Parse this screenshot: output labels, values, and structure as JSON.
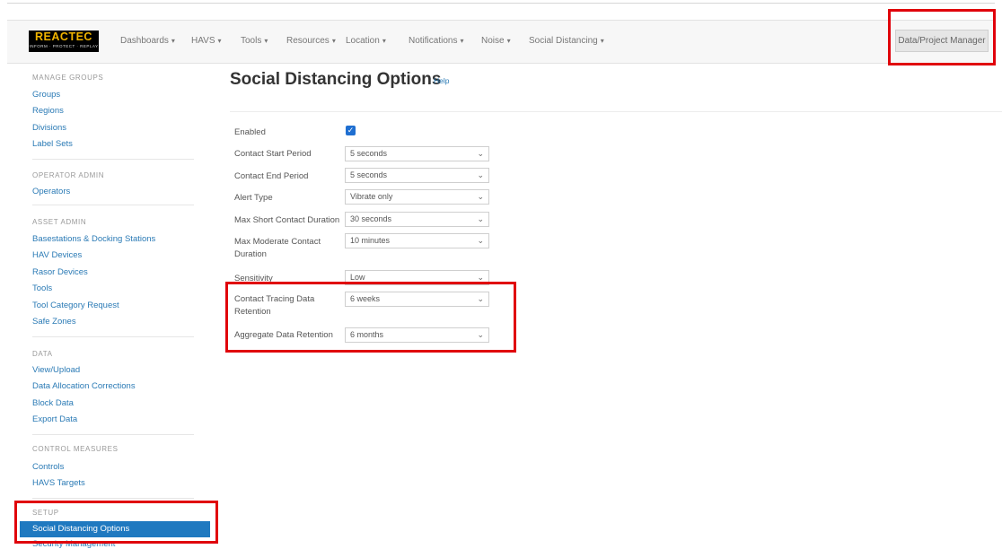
{
  "app": {
    "logo_text": "REACTEC",
    "logo_tagline": "INFORM · PROTECT · REPLAY"
  },
  "nav": {
    "items": [
      {
        "label": "Dashboards",
        "caret": "▾"
      },
      {
        "label": "HAVS",
        "caret": "▾"
      },
      {
        "label": "Tools",
        "caret": "▾"
      },
      {
        "label": "Resources",
        "caret": "▾"
      },
      {
        "label": "Location",
        "caret": "▾"
      },
      {
        "label": "Notifications",
        "caret": "▾"
      },
      {
        "label": "Noise",
        "caret": "▾"
      },
      {
        "label": "Social Distancing",
        "caret": "▾"
      }
    ],
    "right_button": "Data/Project Manager"
  },
  "sidebar": {
    "sections": [
      {
        "heading": "MANAGE GROUPS",
        "links": [
          "Groups",
          "Regions",
          "Divisions",
          "Label Sets"
        ]
      },
      {
        "heading": "OPERATOR ADMIN",
        "links": [
          "Operators"
        ]
      },
      {
        "heading": "ASSET ADMIN",
        "links": [
          "Basestations & Docking Stations",
          "HAV Devices",
          "Rasor Devices",
          "Tools",
          "Tool Category Request",
          "Safe Zones"
        ]
      },
      {
        "heading": "DATA",
        "links": [
          "View/Upload",
          "Data Allocation Corrections",
          "Block Data",
          "Export Data"
        ]
      },
      {
        "heading": "CONTROL MEASURES",
        "links": [
          "Controls",
          "HAVS Targets"
        ]
      },
      {
        "heading": "SETUP",
        "active": "Social Distancing Options",
        "links": [
          "Security Management"
        ]
      }
    ]
  },
  "main": {
    "title": "Social Distancing Options",
    "help_link": "Help",
    "fields": {
      "enabled": {
        "label": "Enabled",
        "checked": true
      },
      "contact_start": {
        "label": "Contact Start Period",
        "value": "5 seconds"
      },
      "contact_end": {
        "label": "Contact End Period",
        "value": "5 seconds"
      },
      "alert_type": {
        "label": "Alert Type",
        "value": "Vibrate only"
      },
      "max_short": {
        "label": "Max Short Contact Duration",
        "value": "30 seconds"
      },
      "max_moderate": {
        "label": "Max Moderate Contact Duration",
        "value": "10 minutes"
      },
      "sensitivity": {
        "label": "Sensitivity",
        "value": "Low"
      },
      "tracing_retention": {
        "label": "Contact Tracing Data Retention",
        "value": "6 weeks"
      },
      "aggregate_retention": {
        "label": "Aggregate Data Retention",
        "value": "6 months"
      }
    }
  },
  "icons": {
    "checkmark": "✓",
    "chevron": "⌄"
  },
  "colors": {
    "highlight": "#e0000b",
    "link": "#2a7ab5",
    "active": "#1f79c0",
    "logo_yellow": "#f0b400"
  }
}
